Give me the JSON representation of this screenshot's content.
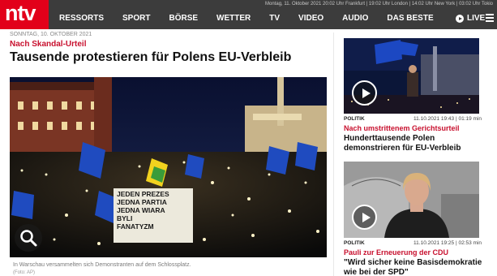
{
  "header": {
    "logo": "ntv",
    "ticker": "Montag, 11. Oktober 2021 20:02 Uhr Frankfurt | 19:02 Uhr London | 14:02 Uhr New York | 03:02 Uhr Tokio",
    "nav": [
      "RESSORTS",
      "SPORT",
      "BÖRSE",
      "WETTER",
      "TV",
      "VIDEO",
      "AUDIO",
      "DAS BESTE"
    ],
    "live_label": "LIVE"
  },
  "article": {
    "date": "SONNTAG, 10. OKTOBER 2021",
    "kicker": "Nach Skandal-Urteil",
    "headline": "Tausende protestieren für Polens EU-Verbleib",
    "sign_text": [
      "JEDEN PREZES",
      "JEDNA PARTIA",
      "JEDNA WIARA",
      "BYLI",
      "FANATYZM"
    ],
    "caption": "In Warschau versammelten sich Demonstranten auf dem Schlossplatz.",
    "credit": "(Foto: AP)"
  },
  "rail": {
    "top_text": "",
    "cards": [
      {
        "category": "POLITIK",
        "timestamp": "11.10.2021 19:43 | 01:19 min",
        "kicker": "Nach umstrittenem Gerichtsurteil",
        "title": "Hunderttausende Polen demonstrieren für EU-Verbleib"
      },
      {
        "category": "POLITIK",
        "timestamp": "11.10.2021 19:25 | 02:53 min",
        "kicker": "Pauli zur Erneuerung der CDU",
        "title": "\"Wird sicher keine Basisdemokratie wie bei der SPD\""
      }
    ]
  },
  "colors": {
    "brand_red": "#e2001a",
    "kicker_red": "#c8102e",
    "nav_bg": "#3c3c3c"
  }
}
